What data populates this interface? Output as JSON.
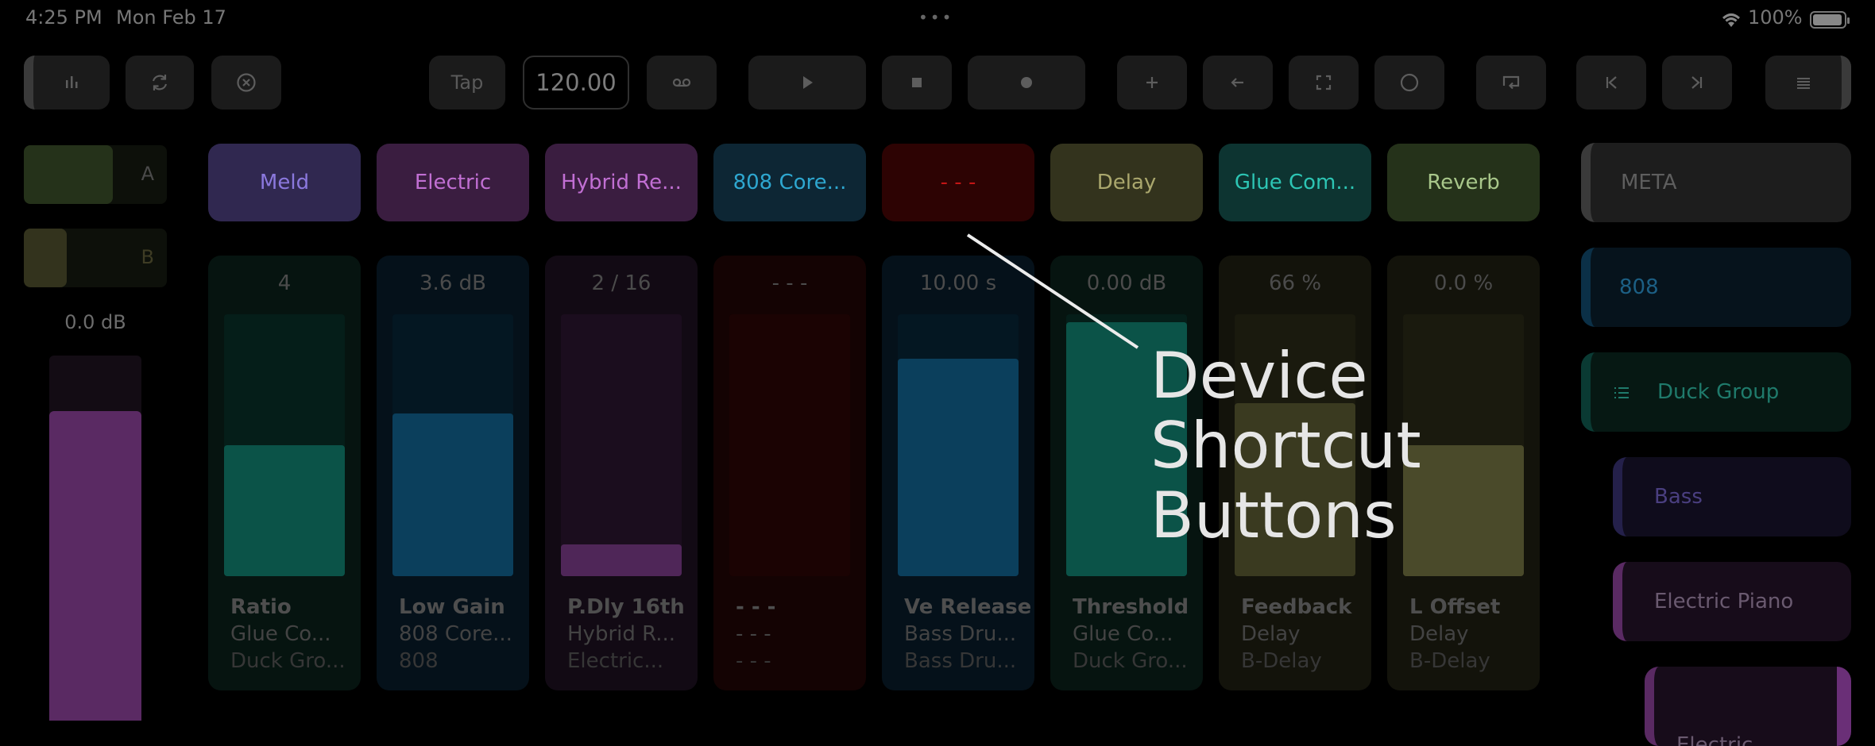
{
  "status": {
    "time": "4:25 PM",
    "date": "Mon Feb 17",
    "dots": "•••",
    "battery": "100%"
  },
  "toolbar": {
    "tap": "Tap",
    "bpm": "120.00"
  },
  "crossfader": {
    "a": {
      "label": "A",
      "level": 0.62,
      "color": "#25321a"
    },
    "b": {
      "label": "B",
      "level": 0.3,
      "color": "#33331d"
    }
  },
  "volume": {
    "value": "0.0 dB",
    "level": 0.86,
    "color": "#5a2a63"
  },
  "devices": [
    {
      "label": "Meld",
      "bg": "#302850",
      "fg": "#8b78dd"
    },
    {
      "label": "Electric",
      "bg": "#3a1d40",
      "fg": "#c16fd3"
    },
    {
      "label": "Hybrid Re...",
      "bg": "#3a1d40",
      "fg": "#c16fd3"
    },
    {
      "label": "808 Core...",
      "bg": "#0d2634",
      "fg": "#2ea7d0"
    },
    {
      "label": "- - -",
      "bg": "#2d0303",
      "fg": "#c31616"
    },
    {
      "label": "Delay",
      "bg": "#33331d",
      "fg": "#aaa76d"
    },
    {
      "label": "Glue Com...",
      "bg": "#0d3431",
      "fg": "#2dc5b4"
    },
    {
      "label": "Reverb",
      "bg": "#25321a",
      "fg": "#a8c78a"
    }
  ],
  "macros": [
    {
      "value": "4",
      "name": "Ratio",
      "device": "Glue Co...",
      "track": "Duck Gro...",
      "level": 0.5,
      "bg": "#061410",
      "trackbg": "#051e19",
      "fill": "#0b5348"
    },
    {
      "value": "3.6 dB",
      "name": "Low Gain",
      "device": "808 Core...",
      "track": "808",
      "level": 0.62,
      "bg": "#05111a",
      "trackbg": "#041722",
      "fill": "#0b3f5c"
    },
    {
      "value": "2  / 16",
      "name": "P.Dly 16th",
      "device": "Hybrid R...",
      "track": "Electric...",
      "level": 0.12,
      "bg": "#120a14",
      "trackbg": "#1b0d1e",
      "fill": "#4f2658"
    },
    {
      "value": "- - -",
      "name": "- - -",
      "device": "- - -",
      "track": "- - -",
      "level": 0,
      "bg": "#140303",
      "trackbg": "#1b0303",
      "fill": "#3a0606"
    },
    {
      "value": "10.00 s",
      "name": "Ve Release",
      "device": "Bass Dru...",
      "track": "Bass Dru...",
      "level": 0.83,
      "bg": "#05111a",
      "trackbg": "#041722",
      "fill": "#0b3f5c"
    },
    {
      "value": "0.00 dB",
      "name": "Threshold",
      "device": "Glue Co...",
      "track": "Duck Gro...",
      "level": 0.97,
      "bg": "#061410",
      "trackbg": "#051e19",
      "fill": "#0b5348"
    },
    {
      "value": "66 %",
      "name": "Feedback",
      "device": "Delay",
      "track": "B-Delay",
      "level": 0.66,
      "bg": "#13130b",
      "trackbg": "#1a1a0e",
      "fill": "#3a3a20"
    },
    {
      "value": "0.0 %",
      "name": "L Offset",
      "device": "Delay",
      "track": "B-Delay",
      "level": 0.5,
      "bg": "#13130b",
      "trackbg": "#1a1a0e",
      "fill": "#4a4a2a"
    }
  ],
  "tracks": [
    {
      "label": "META",
      "bg": "#1d1d1d",
      "fg": "#5e5e5e",
      "accent": "#3a3a3a"
    },
    {
      "label": "808",
      "bg": "#06131c",
      "fg": "#1c5f84",
      "accent": "#0b3047"
    },
    {
      "label": "Duck Group",
      "bg": "#061813",
      "fg": "#1f7a6b",
      "accent": "#0a3a33"
    },
    {
      "label": "Bass",
      "bg": "#0f0c1c",
      "fg": "#4a3f80",
      "accent": "#24204a"
    },
    {
      "label": "Electric Piano",
      "bg": "#170c1a",
      "fg": "#6a5a70",
      "accent": "#5a2a63"
    },
    {
      "label": "Electric",
      "bg": "#170c1a",
      "fg": "#6a5a70",
      "accent": "#5a2a63"
    }
  ],
  "callout": {
    "line1": "Device",
    "line2": "Shortcut",
    "line3": "Buttons"
  }
}
